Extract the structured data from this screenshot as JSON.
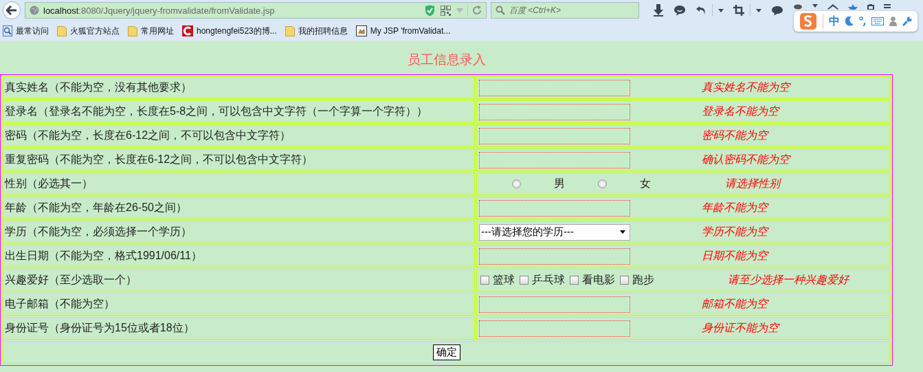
{
  "browser": {
    "url_host": "localhost",
    "url_path": ":8080/Jquery/jquery-fromvalidate/fromValidate.jsp",
    "search_placeholder": "百度 <Ctrl+K>",
    "ime_mode": "中"
  },
  "bookmarks": [
    {
      "kind": "history",
      "label": "最常访问"
    },
    {
      "kind": "folder",
      "label": "火狐官方站点"
    },
    {
      "kind": "folder",
      "label": "常用网址"
    },
    {
      "kind": "site",
      "label": "hongtengfei523的博..."
    },
    {
      "kind": "folder",
      "label": "我的招聘信息"
    },
    {
      "kind": "page",
      "label": "My JSP 'fromValidat..."
    }
  ],
  "page_title": "员工信息录入",
  "rows": [
    {
      "kind": "text",
      "label": "真实姓名（不能为空，没有其他要求）",
      "message": "真实姓名不能为空"
    },
    {
      "kind": "text",
      "label": "登录名（登录名不能为空，长度在5-8之间，可以包含中文字符（一个字算一个字符））",
      "message": "登录名不能为空"
    },
    {
      "kind": "text",
      "label": "密码（不能为空，长度在6-12之间，不可以包含中文字符）",
      "message": "密码不能为空"
    },
    {
      "kind": "text",
      "label": "重复密码（不能为空，长度在6-12之间，不可以包含中文字符）",
      "message": "确认密码不能为空"
    },
    {
      "kind": "radio",
      "label": "性别（必选其一）",
      "options": [
        {
          "label": "男",
          "selected": false
        },
        {
          "label": "女",
          "selected": false
        }
      ],
      "message": "请选择性别"
    },
    {
      "kind": "text",
      "label": "年龄（不能为空，年龄在26-50之间）",
      "message": "年龄不能为空"
    },
    {
      "kind": "select",
      "label": "学历（不能为空，必须选择一个学历）",
      "value": "---请选择您的学历---",
      "message": "学历不能为空"
    },
    {
      "kind": "text",
      "label": "出生日期（不能为空，格式1991/06/11）",
      "message": "日期不能为空"
    },
    {
      "kind": "checkbox",
      "label": "兴趣爱好（至少选取一个）",
      "options": [
        {
          "label": "篮球",
          "checked": false
        },
        {
          "label": "乒乓球",
          "checked": false
        },
        {
          "label": "看电影",
          "checked": false
        },
        {
          "label": "跑步",
          "checked": false
        }
      ],
      "message": "请至少选择一种兴趣爱好"
    },
    {
      "kind": "text",
      "label": "电子邮箱（不能为空）",
      "message": "邮箱不能为空"
    },
    {
      "kind": "text",
      "label": "身份证号（身份证号为15位或者18位）",
      "message": "身份证不能为空"
    }
  ],
  "submit": "确定"
}
